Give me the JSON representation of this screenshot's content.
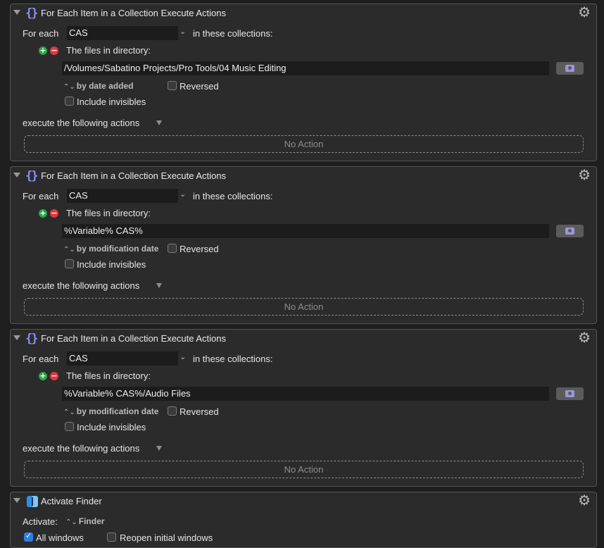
{
  "shared": {
    "for_each_label": "For each",
    "in_collections_label": "in these collections:",
    "files_in_directory_label": "The files in directory:",
    "reversed_label": "Reversed",
    "include_invisibles_label": "Include invisibles",
    "execute_label": "execute the following actions",
    "no_action_label": "No Action",
    "plus_glyph": "+",
    "minus_glyph": "−",
    "sort_glyph": "⌃⌄",
    "gear_glyph": "⚙",
    "chevron_glyph": "⌄"
  },
  "actions": [
    {
      "title": "For Each Item in a Collection Execute Actions",
      "icon": "curly-braces-icon",
      "variable": "CAS",
      "directory_path": "/Volumes/Sabatino Projects/Pro Tools/04 Music Editing",
      "sort_by": "by date added",
      "reversed": false,
      "include_invisibles": false
    },
    {
      "title": "For Each Item in a Collection Execute Actions",
      "icon": "curly-braces-icon",
      "variable": "CAS",
      "directory_path": "%Variable% CAS%",
      "sort_by": "by modification date",
      "reversed": false,
      "include_invisibles": false
    },
    {
      "title": "For Each Item in a Collection Execute Actions",
      "icon": "curly-braces-icon",
      "variable": "CAS",
      "directory_path": "%Variable% CAS%/Audio Files",
      "sort_by": "by modification date",
      "reversed": false,
      "include_invisibles": false
    }
  ],
  "finder_action": {
    "title": "Activate Finder",
    "icon": "finder-icon",
    "activate_label": "Activate:",
    "app": "Finder",
    "all_windows_label": "All windows",
    "all_windows": true,
    "reopen_label": "Reopen initial windows",
    "reopen": false
  },
  "colors": {
    "accent": "#8f8df0",
    "background": "#1e1e1e",
    "panel": "#2b2b2b",
    "plus": "#27a745",
    "minus": "#e0383e"
  }
}
